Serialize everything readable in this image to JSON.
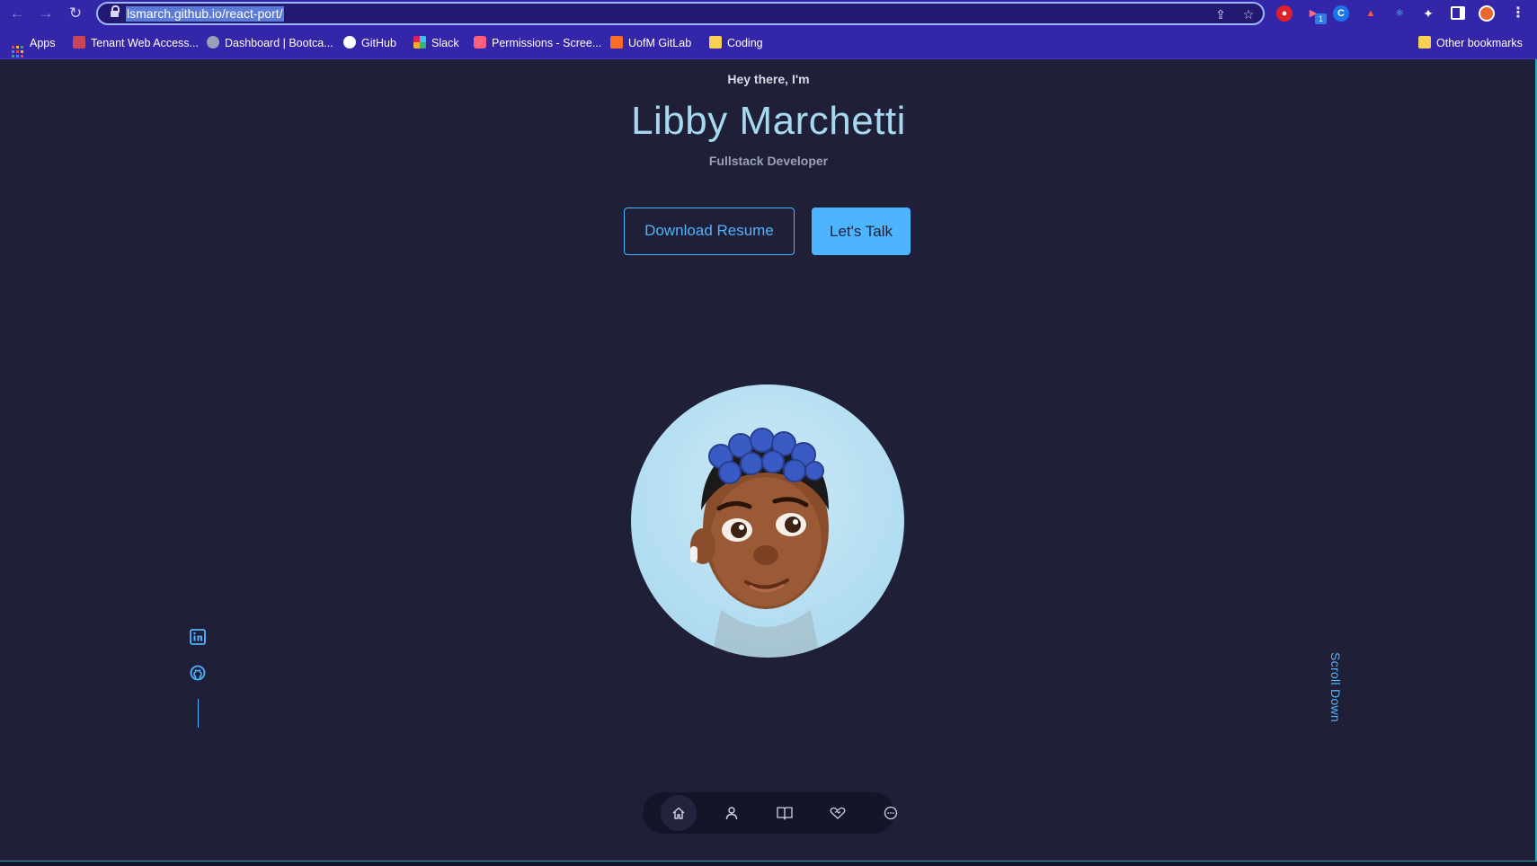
{
  "browser": {
    "url": "lsmarch.github.io/react-port/",
    "bookmarks": [
      {
        "label": "Apps",
        "icon": "apps-grid-icon"
      },
      {
        "label": "Tenant Web Access...",
        "icon": "tenant-icon"
      },
      {
        "label": "Dashboard | Bootca...",
        "icon": "globe-icon"
      },
      {
        "label": "GitHub",
        "icon": "github-icon"
      },
      {
        "label": "Slack",
        "icon": "slack-icon"
      },
      {
        "label": "Permissions - Scree...",
        "icon": "screencastify-icon"
      },
      {
        "label": "UofM GitLab",
        "icon": "gitlab-icon"
      },
      {
        "label": "Coding",
        "icon": "folder-icon"
      }
    ],
    "other_bookmarks": "Other bookmarks",
    "extension_badge": "1"
  },
  "hero": {
    "greeting": "Hey there, I'm",
    "name": "Libby Marchetti",
    "role": "Fullstack Developer",
    "download_label": "Download Resume",
    "talk_label": "Let's Talk"
  },
  "scroll_label": "Scroll Down",
  "nav": [
    {
      "icon": "home-icon",
      "active": true
    },
    {
      "icon": "user-icon",
      "active": false
    },
    {
      "icon": "book-icon",
      "active": false
    },
    {
      "icon": "services-icon",
      "active": false
    },
    {
      "icon": "chat-icon",
      "active": false
    }
  ],
  "colors": {
    "background": "#1f1f38",
    "accent": "#4db5ff",
    "name": "#a6d8f0",
    "chrome": "#3426a8"
  }
}
